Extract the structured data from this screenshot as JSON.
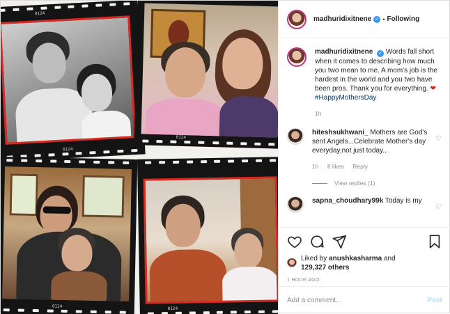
{
  "media": {
    "film_numbers": [
      "0124",
      "0124",
      "0124",
      "0124",
      "0124"
    ]
  },
  "header": {
    "username": "madhuridixitnene",
    "follow_label": "Following"
  },
  "caption": {
    "username": "madhuridixitnene",
    "text": "Words fall short when it comes to describing how much you two mean to me. A mom's job is the hardest in the world and you two have been pros. Thank you for everything.",
    "hashtag": "#HappyMothersDay",
    "time": "1h"
  },
  "comments": [
    {
      "username": "hiteshsukhwani_",
      "text": "Mothers are God's sent Angels...Celebrate Mother's day everyday,not just today..",
      "time": "1h",
      "likes": "8 likes",
      "reply_label": "Reply",
      "view_replies": "View replies (1)"
    },
    {
      "username": "sapna_choudhary99k",
      "text": "Today is my"
    }
  ],
  "likes": {
    "prefix": "Liked by",
    "by_user": "anushkasharma",
    "connector": "and",
    "others": "129,327 others"
  },
  "post_time": "1 HOUR AGO",
  "comment_input": {
    "placeholder": "Add a comment...",
    "post_label": "Post"
  },
  "icons": [
    "verified-badge-icon",
    "heart-icon",
    "comment-icon",
    "share-icon",
    "bookmark-icon",
    "small-heart-icon"
  ],
  "colors": {
    "accent_blue": "#3897f0",
    "link_blue": "#00376b",
    "frame_red": "#d62a23",
    "muted_gray": "#8e8e8e"
  }
}
